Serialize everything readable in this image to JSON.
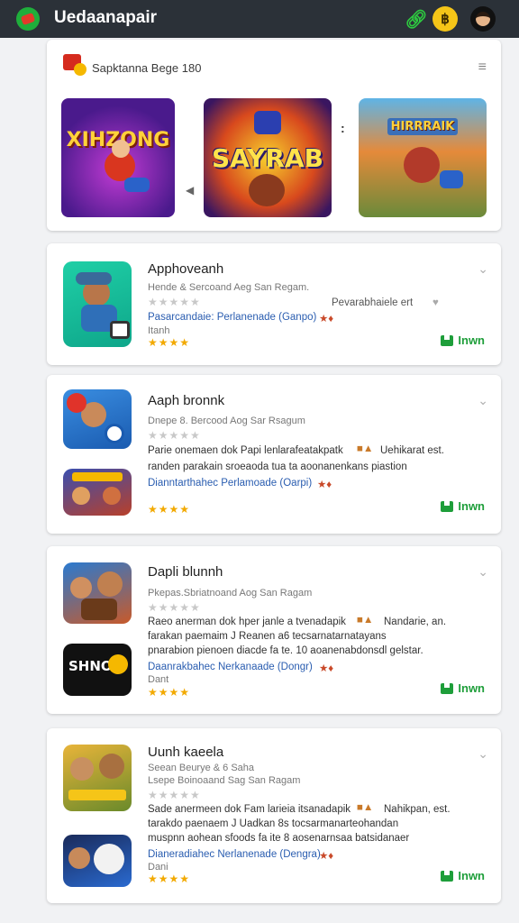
{
  "header": {
    "title": "Uedaanapair",
    "icons": [
      "app-logo-icon",
      "link-icon",
      "coin-icon",
      "avatar-icon"
    ],
    "coin_symbol": "฿"
  },
  "featured": {
    "title": "Sapktanna Bege 180",
    "menu_glyph": "≡",
    "banners": [
      {
        "title": "XIHZONG"
      },
      {
        "title": "SAYRAB"
      },
      {
        "title": "HIRRRAIK"
      }
    ],
    "pager_dots": ":"
  },
  "apps": [
    {
      "name": "Apphoveanh",
      "publisher": "Hende & Sercoand  Aeg San Regam.",
      "side_note": "Pevarabhaiele ert",
      "developer": "Pasarcandaie: Perlanenade (Ganpo)",
      "small_text": "Itanh",
      "install_label": "Inwn"
    },
    {
      "name": "Aaph bronnk",
      "publisher": "Dnepe 8. Bercood  Aog Sar Rsagum",
      "desc_line1": "Parie onemaen dok Papi lenlarafeatakpatk",
      "desc_line1_tail": "Uehikarat est.",
      "desc_line2": "randen parakain sroeaoda tua  ta  aoonanenkans piastion",
      "developer": "Dianntarthahec Perlamoade (Oarpi)",
      "install_label": "Inwn"
    },
    {
      "name": "Dapli blunnh",
      "publisher": "Pkepas.Sbriatnoand  Aog San Ragam",
      "desc_line1": "Raeo anerman dok hper janle a tvenadapik",
      "desc_line1_tail": "Nandarie, an.",
      "desc_line2": "farakan paemaim J Reanen  a6  tecsarnatarnatayans",
      "desc_line3": "pnarabion pienoen diacde fa te.  10  aoanenabdonsdl gelstar.",
      "developer": "Daanrakbahec Nerkanaade (Dongr)",
      "small_text": "Dant",
      "install_label": "Inwn"
    },
    {
      "name": "Uunh kaeela",
      "subtitle": "Seean Beurye & 6  Saha",
      "publisher": "Lsepe Boinoaand  Sag San Ragam",
      "desc_line1": "Sade anermeen dok Fam larieia itsanadapik",
      "desc_line1_tail": "Nahikpan, est.",
      "desc_line2": "tarakdo paenaem J Uadkan 8s  tocsarmanarteohandan",
      "desc_line3": "muspnn aohean sfoods fa   ite  8  aosenarnsaa batsidanaer",
      "developer": "Dianeradiahec Nerlanenade (Dengra)",
      "small_text": "Dani",
      "install_label": "Inwn"
    }
  ],
  "rating_stars": "★★★★",
  "rating_stars_empty": "★★★★★",
  "chevron_glyph": "⌄"
}
